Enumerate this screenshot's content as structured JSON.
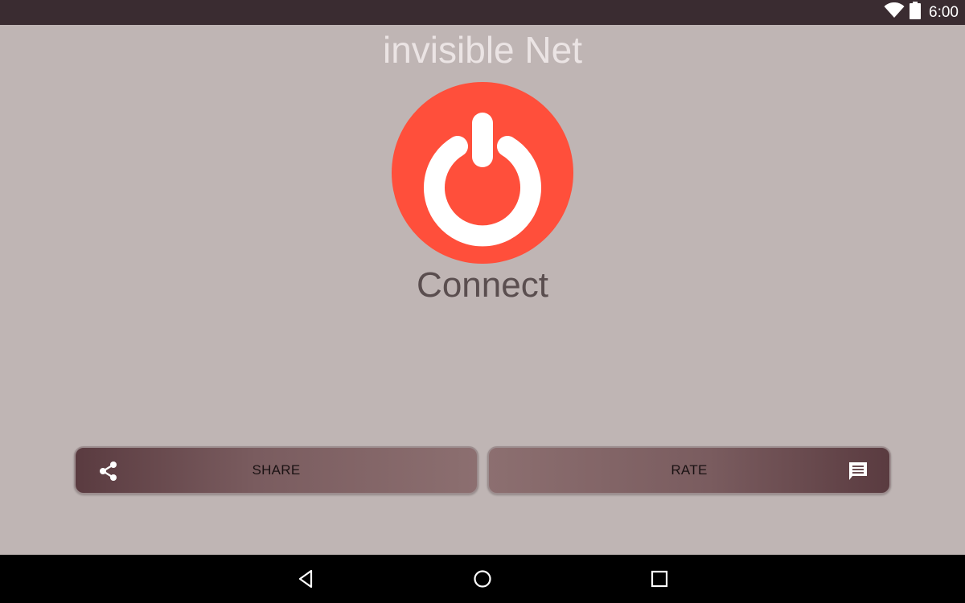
{
  "status_bar": {
    "time": "6:00",
    "icons": [
      "wifi-icon",
      "battery-icon"
    ]
  },
  "app": {
    "title": "invisible Net",
    "power_button": {
      "icon": "power-icon",
      "color": "#ff4f3b",
      "label": "Connect"
    }
  },
  "actions": {
    "share": {
      "label": "SHARE",
      "icon": "share-icon"
    },
    "rate": {
      "label": "RATE",
      "icon": "message-icon"
    }
  },
  "navigation": {
    "buttons": [
      "back-icon",
      "home-icon",
      "recents-icon"
    ]
  },
  "colors": {
    "background": "#bfb5b4",
    "status_bar": "#3a2c31",
    "accent": "#ff4f3b",
    "button_dark": "#5a3b40",
    "button_light": "#8c6f70"
  }
}
